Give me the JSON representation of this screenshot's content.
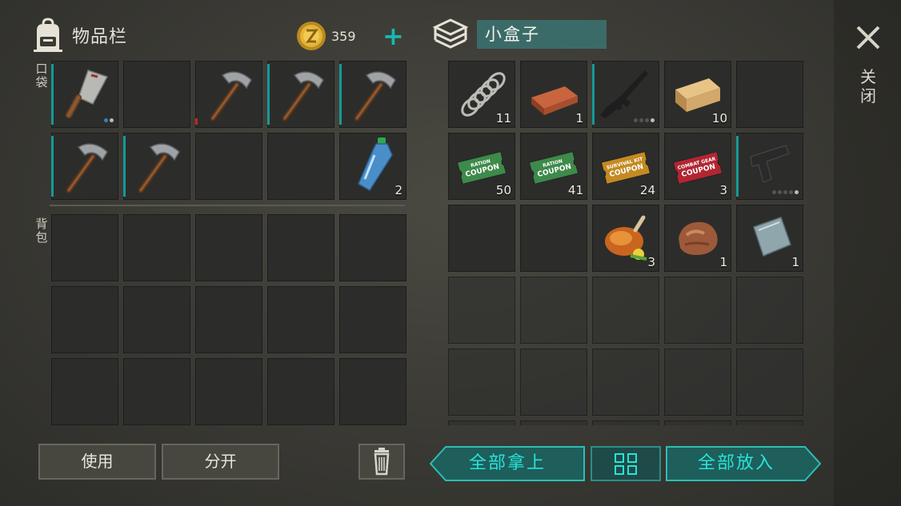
{
  "inventory": {
    "title": "物品栏",
    "coins": "359",
    "pocket_label": "口袋",
    "backpack_label": "背包"
  },
  "box": {
    "title": "小盒子"
  },
  "close_label": "关闭",
  "buttons": {
    "use": "使用",
    "split": "分开",
    "take_all": "全部拿上",
    "put_all": "全部放入"
  },
  "pocket_slots": [
    {
      "item": "cleaver-icon",
      "qty": "",
      "bar": "teal",
      "dots": [
        1,
        1
      ]
    },
    {
      "item": "",
      "qty": ""
    },
    {
      "item": "pickaxe-icon",
      "qty": "",
      "bar": "red"
    },
    {
      "item": "pickaxe-icon",
      "qty": "",
      "bar": "teal"
    },
    {
      "item": "pickaxe-icon",
      "qty": "",
      "bar": "teal"
    },
    {
      "item": "pickaxe-icon",
      "qty": "",
      "bar": "teal"
    },
    {
      "item": "pickaxe-icon",
      "qty": "",
      "bar": "teal"
    },
    {
      "item": "",
      "qty": ""
    },
    {
      "item": "",
      "qty": ""
    },
    {
      "item": "water-bottle-icon",
      "qty": "2"
    }
  ],
  "box_slots": [
    {
      "item": "spring-icon",
      "qty": "11"
    },
    {
      "item": "copper-ingot-icon",
      "qty": "1"
    },
    {
      "item": "assault-rifle-icon",
      "qty": "",
      "bar": "teal",
      "dots": [
        1,
        1,
        1,
        1
      ]
    },
    {
      "item": "wood-plank-icon",
      "qty": "10"
    },
    {
      "item": "",
      "qty": ""
    },
    {
      "item": "ration-coupon-icon",
      "qty": "50",
      "label": "RATION COUPON"
    },
    {
      "item": "ration-coupon-icon",
      "qty": "41",
      "label": "RATION COUPON"
    },
    {
      "item": "survival-kit-coupon-icon",
      "qty": "24",
      "label": "SURVIVAL KIT COUPON"
    },
    {
      "item": "combat-gear-coupon-icon",
      "qty": "3",
      "label": "COMBAT GEAR COUPON"
    },
    {
      "item": "pistol-icon",
      "qty": "",
      "bar": "teal",
      "dots": [
        1,
        1,
        1,
        1,
        1
      ]
    },
    {
      "item": "",
      "qty": ""
    },
    {
      "item": "",
      "qty": ""
    },
    {
      "item": "roast-chicken-icon",
      "qty": "3"
    },
    {
      "item": "meat-chunk-icon",
      "qty": "1"
    },
    {
      "item": "metal-plate-icon",
      "qty": "1"
    }
  ],
  "colors": {
    "accent": "#19b7b0",
    "slot_bg": "#2c2d2b",
    "durability": "#159a96"
  }
}
